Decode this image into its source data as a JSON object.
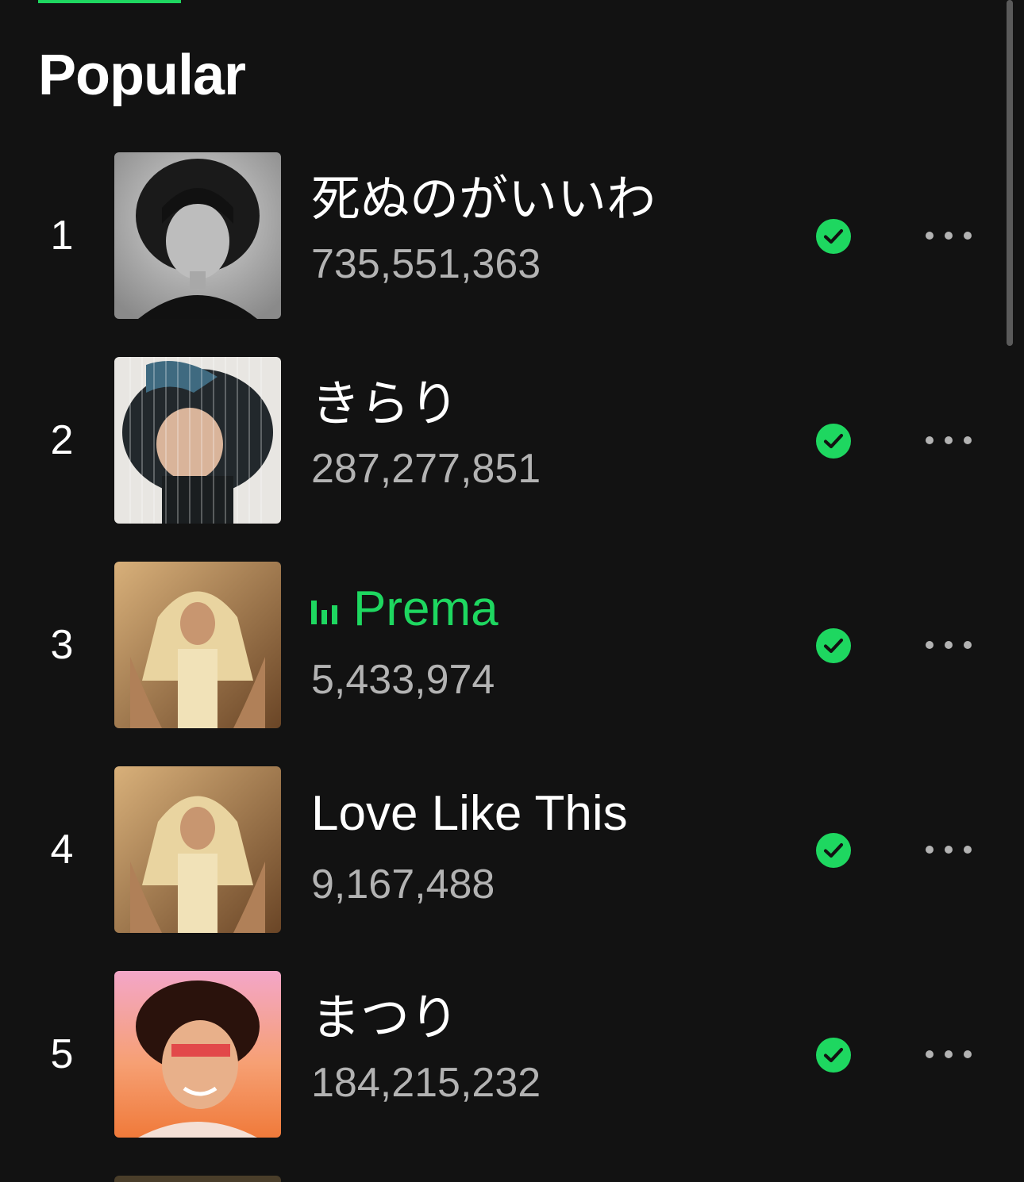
{
  "section": {
    "title": "Popular"
  },
  "tracks": [
    {
      "rank": "1",
      "title": "死ぬのがいいわ",
      "plays": "735,551,363",
      "playing": false
    },
    {
      "rank": "2",
      "title": "きらり",
      "plays": "287,277,851",
      "playing": false
    },
    {
      "rank": "3",
      "title": "Prema",
      "plays": "5,433,974",
      "playing": true
    },
    {
      "rank": "4",
      "title": "Love Like This",
      "plays": "9,167,488",
      "playing": false
    },
    {
      "rank": "5",
      "title": "まつり",
      "plays": "184,215,232",
      "playing": false
    }
  ],
  "icons": {
    "saved": "check-circle-icon",
    "more": "more-horizontal-icon",
    "playing": "equalizer-icon"
  },
  "colors": {
    "background": "#121212",
    "accent": "#1ed760",
    "primary_text": "#ffffff",
    "secondary_text": "#b3b3b3"
  }
}
